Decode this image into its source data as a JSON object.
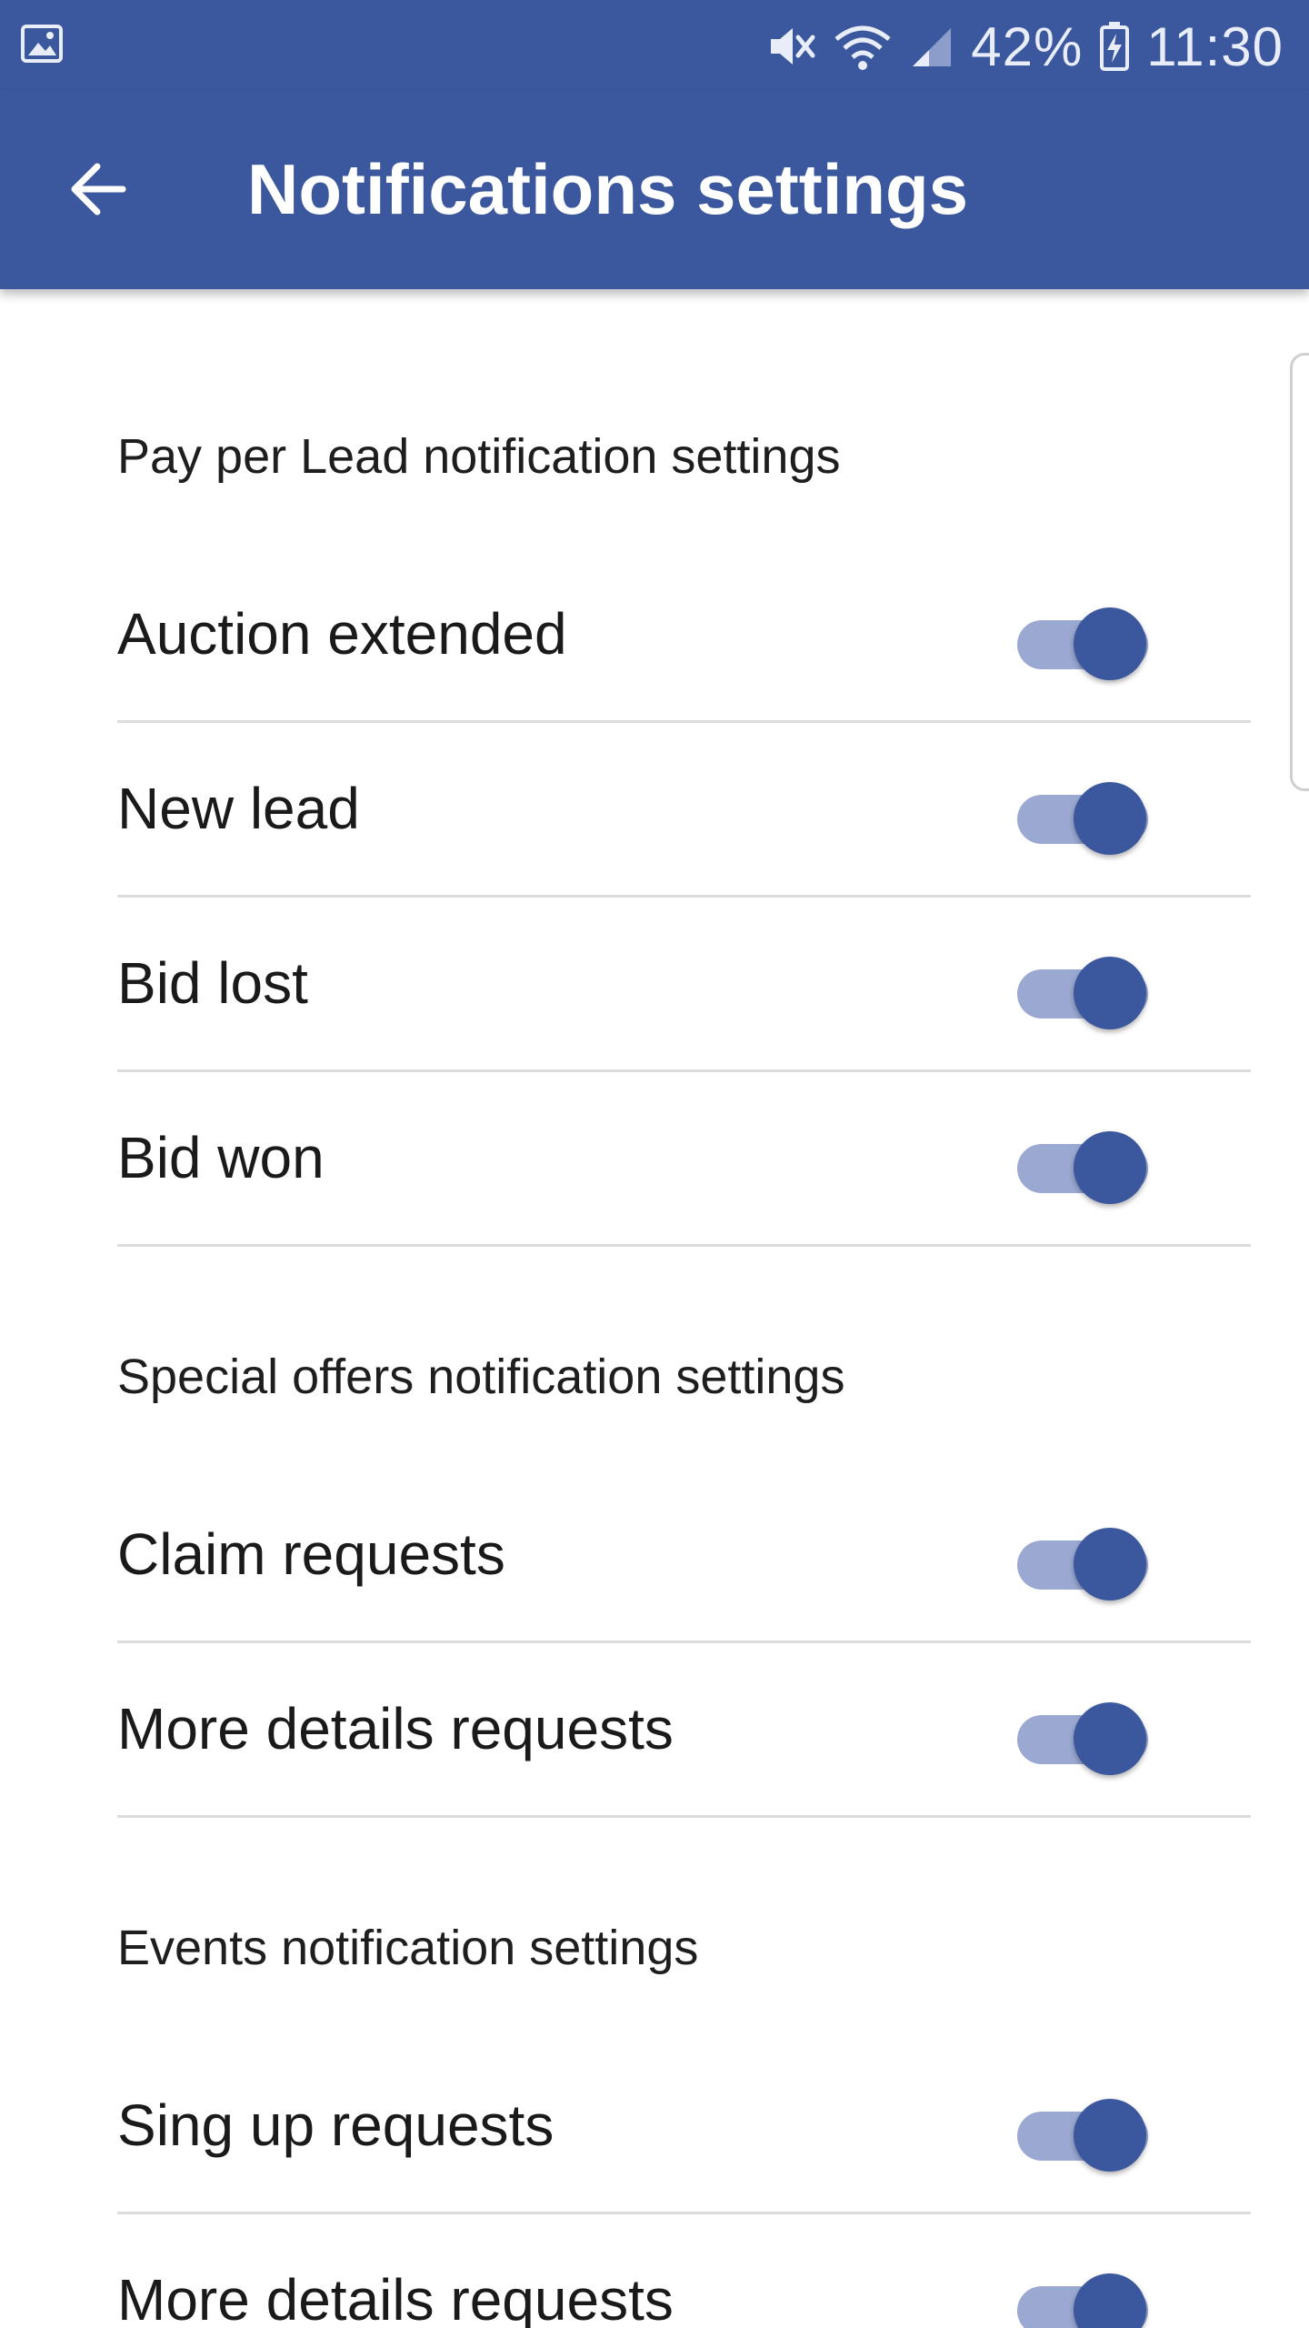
{
  "colors": {
    "primary": "#3b579d",
    "toggle_track": "#9aa8d2",
    "divider": "#dcdcdc"
  },
  "status_bar": {
    "battery": "42%",
    "time": "11:30",
    "icons": [
      "gallery-notification-icon",
      "mute-icon",
      "wifi-icon",
      "cellular-signal-icon",
      "battery-charging-icon"
    ]
  },
  "app_bar": {
    "title": "Notifications settings",
    "back_icon": "arrow-back-icon"
  },
  "sections": [
    {
      "header": "Pay per Lead notification settings",
      "items": [
        {
          "label": "Auction extended",
          "enabled": true
        },
        {
          "label": "New lead",
          "enabled": true
        },
        {
          "label": "Bid lost",
          "enabled": true
        },
        {
          "label": "Bid won",
          "enabled": true
        }
      ]
    },
    {
      "header": "Special offers notification settings",
      "items": [
        {
          "label": "Claim requests",
          "enabled": true
        },
        {
          "label": "More details requests",
          "enabled": true
        }
      ]
    },
    {
      "header": "Events notification settings",
      "items": [
        {
          "label": "Sing up requests",
          "enabled": true
        },
        {
          "label": "More details requests",
          "enabled": true
        }
      ]
    }
  ]
}
